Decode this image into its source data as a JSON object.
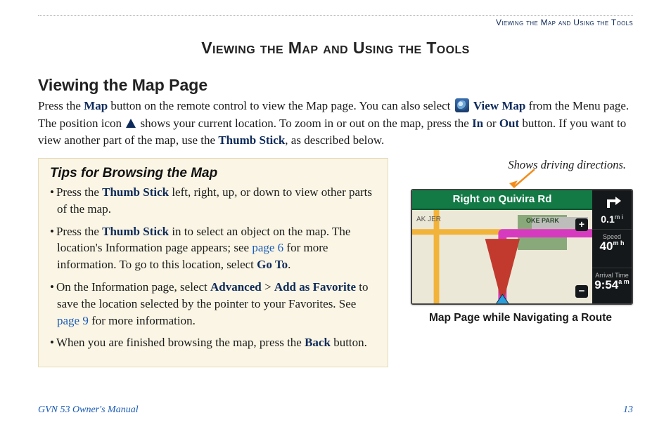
{
  "header": {
    "running_head": "Viewing the Map and Using the Tools"
  },
  "chapter_title": "Viewing the Map and Using the Tools",
  "section_title": "Viewing the Map Page",
  "intro": {
    "t1": "Press the ",
    "kw_map": "Map",
    "t2": " button on the remote control to view the Map page. You can also select ",
    "kw_viewmap": "View Map",
    "t3": " from the Menu page. The position icon ",
    "t4": " shows your current location. To zoom in or out on the map, press the ",
    "kw_in": "In",
    "t5": " or ",
    "kw_out": "Out",
    "t6": " button. If you want to view another part of the map, use the ",
    "kw_thumb": "Thumb Stick",
    "t7": ", as described below."
  },
  "tips": {
    "title": "Tips for Browsing the Map",
    "items": [
      {
        "pre": "Press the ",
        "kw1": "Thumb Stick",
        "post": " left, right, up, or down to view other parts of the map."
      },
      {
        "pre": "Press the ",
        "kw1": "Thumb Stick",
        "mid1": " in to select an object on the map. The location's Information page appears; see ",
        "link1": "page 6",
        "mid2": " for more information. To go to this location, select ",
        "kw2": "Go To",
        "post": "."
      },
      {
        "pre": "On the Information page, select ",
        "kw1": "Advanced",
        "sep": " > ",
        "kw2": "Add as Favorite",
        "mid1": " to save the location selected by the pointer to your Favorites. See ",
        "link1": "page 9",
        "post": " for more information."
      },
      {
        "pre": "When you are finished browsing the map, press the ",
        "kw1": "Back",
        "post": " button."
      }
    ]
  },
  "figure": {
    "callout": "Shows driving directions.",
    "banner": "Right on Quivira Rd",
    "park_label": "OKE PARK",
    "ak_label": "AK JER",
    "turn_distance": "0.1",
    "turn_unit": "m i",
    "speed_label": "Speed",
    "speed_value": "40",
    "speed_unit": "m h",
    "arrival_label": "Arrival Time",
    "arrival_value": "9:54",
    "arrival_unit": "a m",
    "zoom_plus": "+",
    "zoom_minus": "−",
    "caption": "Map Page while Navigating a Route"
  },
  "footer": {
    "left": "GVN 53 Owner's Manual",
    "right": "13"
  }
}
